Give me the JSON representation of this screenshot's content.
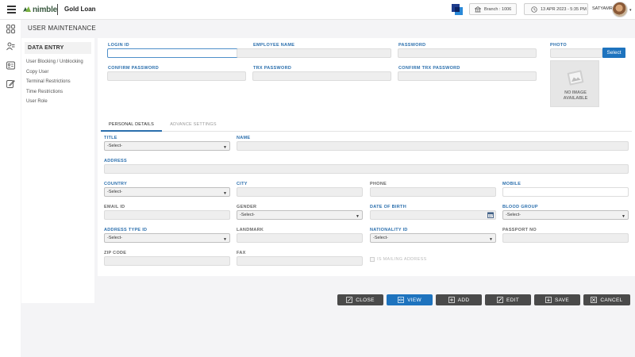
{
  "header": {
    "logo_text": "nimble",
    "product": "Gold Loan",
    "branch": "Branch : 1006",
    "datetime": "13 APR 2023 - 5:35 PM",
    "user": "SATYAMR"
  },
  "page_title": "USER MAINTENANCE",
  "sidebar": {
    "header": "DATA ENTRY",
    "items": [
      {
        "label": "User Blocking / Unblocking"
      },
      {
        "label": "Copy User"
      },
      {
        "label": "Terminal Restrictions"
      },
      {
        "label": "Time Restrictions"
      },
      {
        "label": "User Role"
      }
    ]
  },
  "form": {
    "login_id": {
      "label": "LOGIN ID",
      "value": ""
    },
    "employee_name": {
      "label": "EMPLOYEE NAME",
      "value": ""
    },
    "password": {
      "label": "PASSWORD",
      "value": ""
    },
    "photo": {
      "label": "PHOTO",
      "value": "",
      "select_label": "Select",
      "no_image_line1": "NO IMAGE",
      "no_image_line2": "AVAILABLE"
    },
    "confirm_password": {
      "label": "CONFIRM PASSWORD",
      "value": ""
    },
    "trx_password": {
      "label": "TRX PASSWORD",
      "value": ""
    },
    "confirm_trx_password": {
      "label": "CONFIRM TRX PASSWORD",
      "value": ""
    }
  },
  "tabs": [
    {
      "label": "PERSONAL DETAILS",
      "active": true
    },
    {
      "label": "ADVANCE SETTINGS",
      "active": false
    }
  ],
  "personal": {
    "title": {
      "label": "TITLE",
      "value": "-Select-"
    },
    "name": {
      "label": "NAME",
      "value": ""
    },
    "address": {
      "label": "ADDRESS",
      "value": ""
    },
    "country": {
      "label": "COUNTRY",
      "value": "-Select-"
    },
    "city": {
      "label": "CITY",
      "value": ""
    },
    "phone": {
      "label": "PHONE",
      "value": ""
    },
    "mobile": {
      "label": "MOBILE",
      "value": ""
    },
    "email": {
      "label": "EMAIL ID",
      "value": ""
    },
    "gender": {
      "label": "GENDER",
      "value": "-Select-"
    },
    "dob": {
      "label": "DATE OF BIRTH",
      "value": ""
    },
    "blood_group": {
      "label": "BLOOD GROUP",
      "value": "-Select-"
    },
    "address_type": {
      "label": "ADDRESS TYPE ID",
      "value": "-Select-"
    },
    "landmark": {
      "label": "LANDMARK",
      "value": ""
    },
    "nationality": {
      "label": "NATIONALITY ID",
      "value": "-Select-"
    },
    "passport": {
      "label": "PASSPORT NO",
      "value": ""
    },
    "zip": {
      "label": "ZIP CODE",
      "value": ""
    },
    "fax": {
      "label": "FAX",
      "value": ""
    },
    "mailing": {
      "label": "IS MAILING ADDRESS",
      "checked": false
    }
  },
  "actions": {
    "close": "CLOSE",
    "view": "VIEW",
    "add": "ADD",
    "edit": "EDIT",
    "save": "SAVE",
    "cancel": "CANCEL"
  },
  "colors": {
    "accent": "#1e73be",
    "label": "#2b6fad",
    "button_dark": "#4a4a4a"
  }
}
